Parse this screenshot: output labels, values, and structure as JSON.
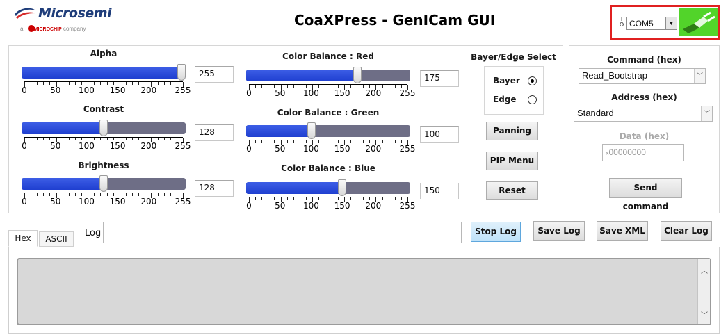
{
  "header": {
    "logo_name": "Microsemi",
    "logo_sub_prefix": "a",
    "logo_sub_brand": "MICROCHIP",
    "logo_sub_suffix": "company",
    "title": "CoaXPress - GenICam GUI"
  },
  "com": {
    "port": "COM5",
    "io_icon": "io-icon",
    "connect_icon": "usb-plug-icon",
    "connect_color": "#52d42a"
  },
  "scale_labels": [
    "0",
    "50",
    "100",
    "150",
    "200",
    "255"
  ],
  "sliders": [
    {
      "label": "Alpha",
      "value": "255",
      "fraction": 1.0
    },
    {
      "label": "Contrast",
      "value": "128",
      "fraction": 0.502
    },
    {
      "label": "Brightness",
      "value": "128",
      "fraction": 0.502
    },
    {
      "label": "Color Balance : Red",
      "value": "175",
      "fraction": 0.686
    },
    {
      "label": "Color Balance : Green",
      "value": "100",
      "fraction": 0.392
    },
    {
      "label": "Color Balance : Blue",
      "value": "150",
      "fraction": 0.588
    }
  ],
  "bayer_edge": {
    "title": "Bayer/Edge Select",
    "options": [
      "Bayer",
      "Edge"
    ],
    "selected": "Bayer"
  },
  "side_buttons": {
    "panning": "Panning",
    "pip_menu": "PIP Menu",
    "reset": "Reset"
  },
  "command_panel": {
    "command_label": "Command (hex)",
    "command_value": "Read_Bootstrap",
    "address_label": "Address (hex)",
    "address_value": "Standard",
    "data_label": "Data (hex)",
    "data_prefix": "x",
    "data_value": "00000000",
    "send_button": "Send command"
  },
  "log": {
    "tabs": [
      "Hex",
      "ASCII"
    ],
    "selected_tab": "Hex",
    "label": "Log",
    "value": "",
    "stop_button": "Stop Log",
    "save_button": "Save Log",
    "save_xml_button": "Save XML",
    "clear_button": "Clear Log"
  },
  "colors": {
    "slider_fill": "#1f3fd0",
    "slider_track": "#6e6e86",
    "highlight_border": "#e02020",
    "active_button": "#bfe2f9"
  }
}
